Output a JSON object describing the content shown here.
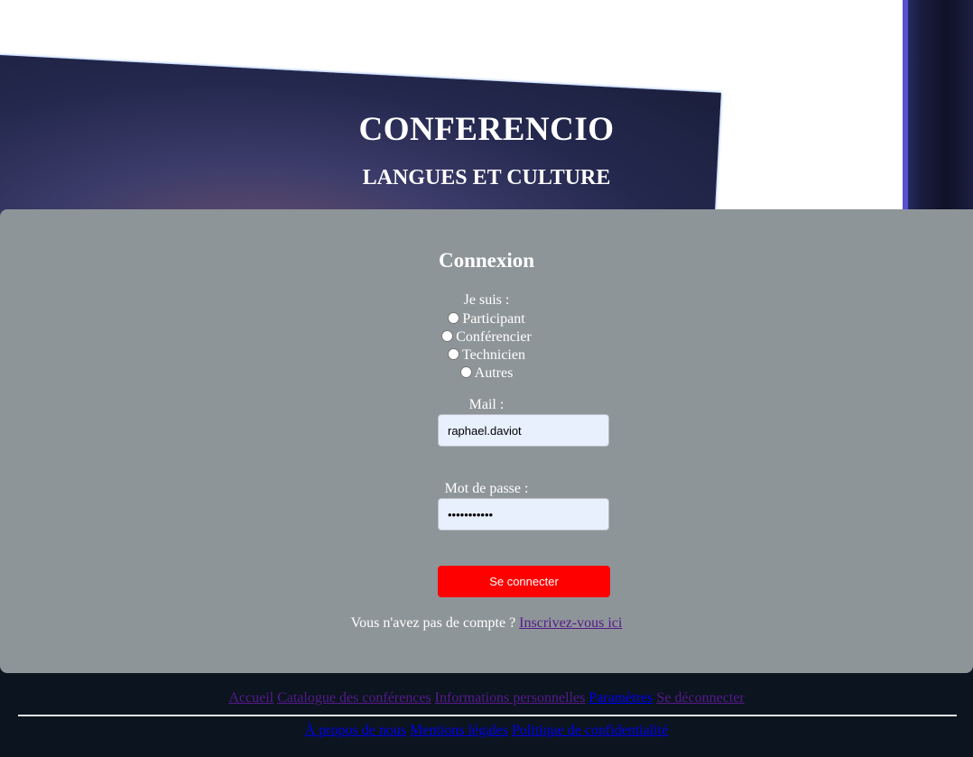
{
  "header": {
    "title": "CONFERENCIO",
    "subtitle": "LANGUES ET CULTURE"
  },
  "login": {
    "title": "Connexion",
    "role_label": "Je suis :",
    "roles": [
      "Participant",
      "Conférencier",
      "Technicien",
      "Autres"
    ],
    "mail_label": "Mail :",
    "mail_value": "raphael.daviot",
    "password_label": "Mot de passe :",
    "password_value": "•••••••••••",
    "submit_label": "Se connecter",
    "signup_text": "Vous n'avez pas de compte ?",
    "signup_link": "Inscrivez-vous ici",
    "submit_color": "#ff0000"
  },
  "footer": {
    "nav": [
      "Accueil",
      "Catalogue des conférences",
      "Informations personnelles",
      "Paramètres",
      "Se déconnecter"
    ],
    "legal": [
      "À propos de nous",
      "Mentions légales",
      "Politique de confidentialité"
    ]
  }
}
